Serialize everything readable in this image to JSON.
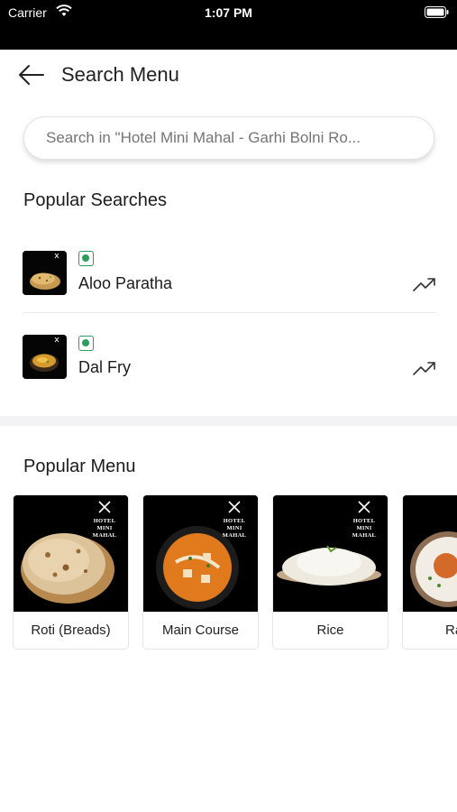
{
  "status_bar": {
    "carrier": "Carrier",
    "time": "1:07 PM"
  },
  "header": {
    "title": "Search Menu",
    "back_icon": "arrow-left-icon"
  },
  "search": {
    "placeholder": "Search in \"Hotel Mini Mahal - Garhi Bolni Ro..."
  },
  "popular_searches": {
    "title": "Popular Searches",
    "items": [
      {
        "name": "Aloo Paratha",
        "veg": true,
        "icon": "trending-up-icon"
      },
      {
        "name": "Dal Fry",
        "veg": true,
        "icon": "trending-up-icon"
      }
    ]
  },
  "popular_menu": {
    "title": "Popular Menu",
    "brand_line1": "HOTEL",
    "brand_line2": "MINI MAHAL",
    "cards": [
      {
        "label": "Roti (Breads)"
      },
      {
        "label": "Main Course"
      },
      {
        "label": "Rice"
      },
      {
        "label": "Raita"
      }
    ]
  },
  "colors": {
    "veg_green": "#2e9d5b",
    "status_bar_bg": "#000000"
  }
}
